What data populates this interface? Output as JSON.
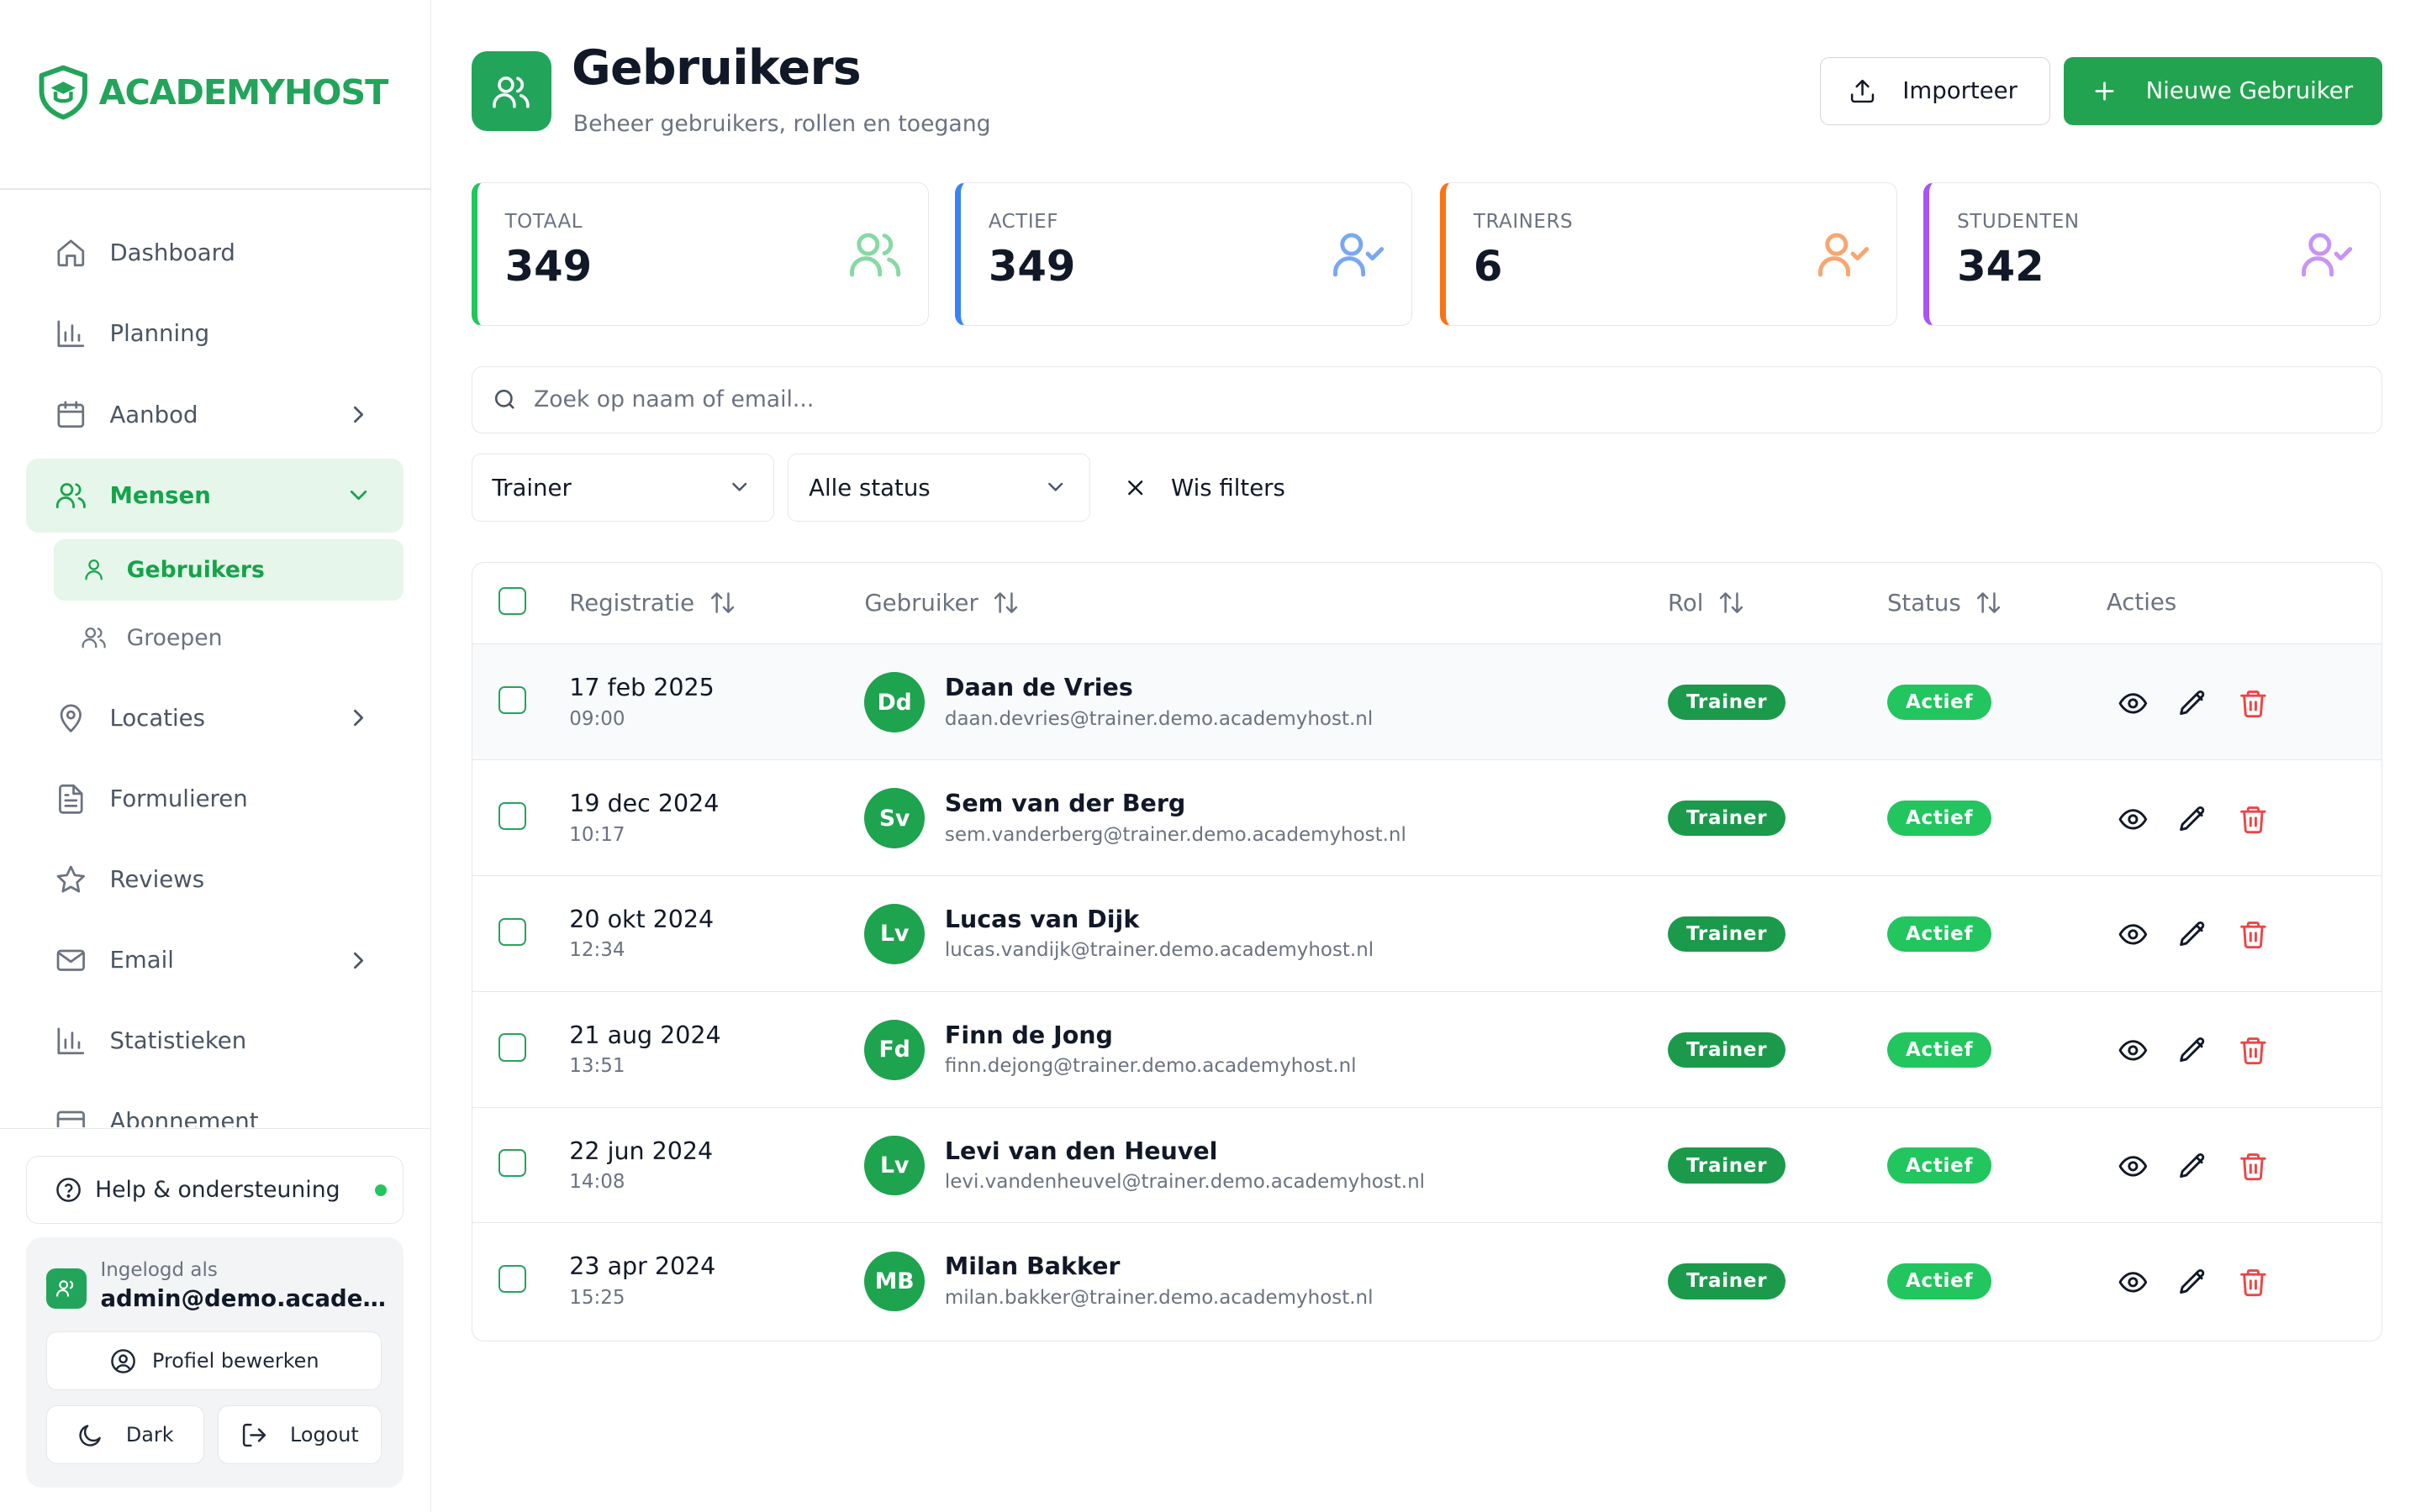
{
  "brand": {
    "name": "ACADEMYHOST",
    "color": "#22a45a"
  },
  "sidebar": {
    "items": [
      {
        "key": "dashboard",
        "label": "Dashboard",
        "icon": "home-icon",
        "chevron": ""
      },
      {
        "key": "planning",
        "label": "Planning",
        "icon": "bar-chart-icon",
        "chevron": ""
      },
      {
        "key": "aanbod",
        "label": "Aanbod",
        "icon": "calendar-icon",
        "chevron": "right"
      },
      {
        "key": "mensen",
        "label": "Mensen",
        "icon": "users-icon",
        "chevron": "down",
        "active": true
      },
      {
        "key": "locaties",
        "label": "Locaties",
        "icon": "map-pin-icon",
        "chevron": "right"
      },
      {
        "key": "formulieren",
        "label": "Formulieren",
        "icon": "file-text-icon",
        "chevron": ""
      },
      {
        "key": "reviews",
        "label": "Reviews",
        "icon": "star-icon",
        "chevron": ""
      },
      {
        "key": "email",
        "label": "Email",
        "icon": "mail-icon",
        "chevron": "right"
      },
      {
        "key": "statistieken",
        "label": "Statistieken",
        "icon": "bar-chart-icon",
        "chevron": ""
      },
      {
        "key": "abonnement",
        "label": "Abonnement",
        "icon": "credit-card-icon",
        "chevron": ""
      }
    ],
    "subitems": [
      {
        "label": "Gebruikers",
        "icon": "user-icon",
        "active": true
      },
      {
        "label": "Groepen",
        "icon": "users-icon",
        "active": false
      }
    ],
    "help_label": "Help & ondersteuning",
    "logged_in_label": "Ingelogd als",
    "logged_in_email": "admin@demo.academ...",
    "profile_label": "Profiel bewerken",
    "dark_label": "Dark",
    "logout_label": "Logout"
  },
  "header": {
    "title": "Gebruikers",
    "subtitle": "Beheer gebruikers, rollen en toegang",
    "import_label": "Importeer",
    "new_label": "Nieuwe Gebruiker"
  },
  "stats": [
    {
      "label": "TOTAAL",
      "value": "349",
      "color": "#22c55e",
      "icon": "users-icon"
    },
    {
      "label": "ACTIEF",
      "value": "349",
      "color": "#3b82f6",
      "icon": "user-check-icon"
    },
    {
      "label": "TRAINERS",
      "value": "6",
      "color": "#f97316",
      "icon": "user-check-icon"
    },
    {
      "label": "STUDENTEN",
      "value": "342",
      "color": "#a855f7",
      "icon": "user-check-icon"
    }
  ],
  "search": {
    "placeholder": "Zoek op naam of email...",
    "value": ""
  },
  "filters": {
    "role": "Trainer",
    "status": "Alle status",
    "clear_label": "Wis filters"
  },
  "table": {
    "columns": [
      "Registratie",
      "Gebruiker",
      "Rol",
      "Status",
      "Acties"
    ],
    "rows": [
      {
        "date": "17 feb 2025",
        "time": "09:00",
        "initials": "Dd",
        "name": "Daan de Vries",
        "email": "daan.devries@trainer.demo.academyhost.nl",
        "role": "Trainer",
        "status": "Actief"
      },
      {
        "date": "19 dec 2024",
        "time": "10:17",
        "initials": "Sv",
        "name": "Sem van der Berg",
        "email": "sem.vanderberg@trainer.demo.academyhost.nl",
        "role": "Trainer",
        "status": "Actief"
      },
      {
        "date": "20 okt 2024",
        "time": "12:34",
        "initials": "Lv",
        "name": "Lucas van Dijk",
        "email": "lucas.vandijk@trainer.demo.academyhost.nl",
        "role": "Trainer",
        "status": "Actief"
      },
      {
        "date": "21 aug 2024",
        "time": "13:51",
        "initials": "Fd",
        "name": "Finn de Jong",
        "email": "finn.dejong@trainer.demo.academyhost.nl",
        "role": "Trainer",
        "status": "Actief"
      },
      {
        "date": "22 jun 2024",
        "time": "14:08",
        "initials": "Lv",
        "name": "Levi van den Heuvel",
        "email": "levi.vandenheuvel@trainer.demo.academyhost.nl",
        "role": "Trainer",
        "status": "Actief"
      },
      {
        "date": "23 apr 2024",
        "time": "15:25",
        "initials": "MB",
        "name": "Milan Bakker",
        "email": "milan.bakker@trainer.demo.academyhost.nl",
        "role": "Trainer",
        "status": "Actief"
      }
    ]
  }
}
